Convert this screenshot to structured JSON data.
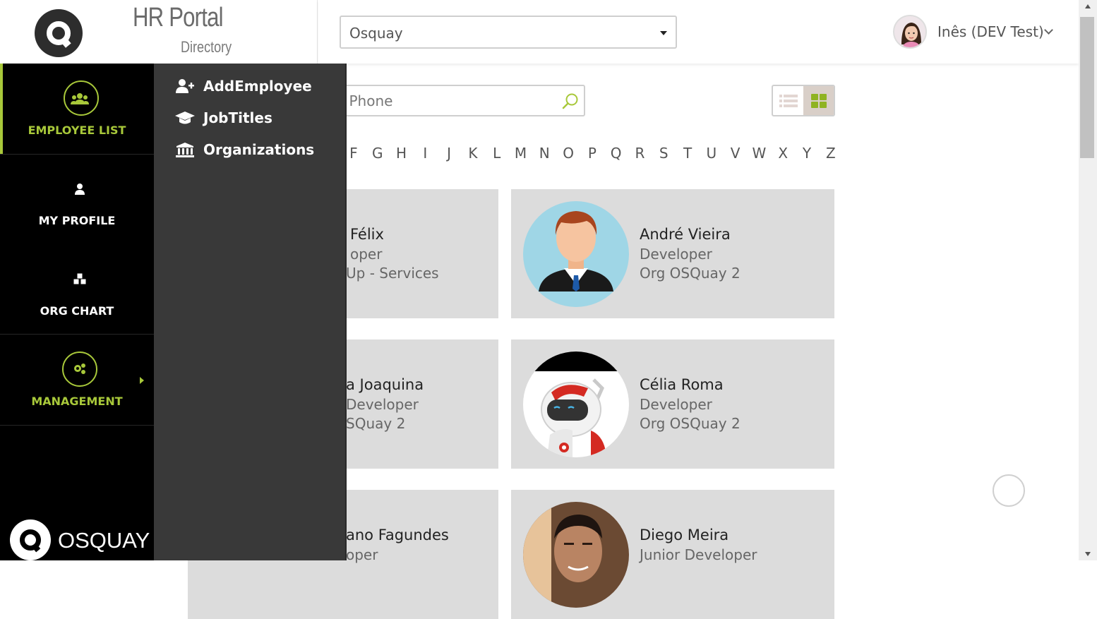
{
  "header": {
    "title": "HR Portal",
    "subtitle": "Directory"
  },
  "company_select": {
    "value": "Osquay"
  },
  "user": {
    "name": "Inês (DEV Test)"
  },
  "search": {
    "placeholder": "bile Phone"
  },
  "alphabet": [
    "F",
    "G",
    "H",
    "I",
    "J",
    "K",
    "L",
    "M",
    "N",
    "O",
    "P",
    "Q",
    "R",
    "S",
    "T",
    "U",
    "V",
    "W",
    "X",
    "Y",
    "Z"
  ],
  "nav": {
    "items": [
      {
        "label": "EMPLOYEE LIST",
        "icon": "users-icon"
      },
      {
        "label": "MY PROFILE",
        "icon": "user-icon"
      },
      {
        "label": "ORG CHART",
        "icon": "cubes-icon"
      },
      {
        "label": "MANAGEMENT",
        "icon": "cogs-icon"
      }
    ],
    "brand": "OSQUAY"
  },
  "submenu": {
    "items": [
      {
        "label": "AddEmployee",
        "icon": "user-plus-icon"
      },
      {
        "label": "JobTitles",
        "icon": "graduation-cap-icon"
      },
      {
        "label": "Organizations",
        "icon": "institution-icon"
      }
    ]
  },
  "employees": [
    {
      "name": "Félix",
      "job": "oper",
      "org": "Up - Services"
    },
    {
      "name": "André Vieira",
      "job": "Developer",
      "org": "Org OSQuay 2"
    },
    {
      "name": "a Joaquina",
      "job": "Developer",
      "org": "SQuay 2"
    },
    {
      "name": "Célia Roma",
      "job": "Developer",
      "org": "Org OSQuay 2"
    },
    {
      "name": "ano Fagundes",
      "job": "oper",
      "org": ""
    },
    {
      "name": "Diego Meira",
      "job": "Junior Developer",
      "org": ""
    }
  ],
  "colors": {
    "accent": "#a8c83a",
    "nav_bg": "#000000",
    "submenu_bg": "#393939",
    "card_bg": "#dcdcdc"
  }
}
